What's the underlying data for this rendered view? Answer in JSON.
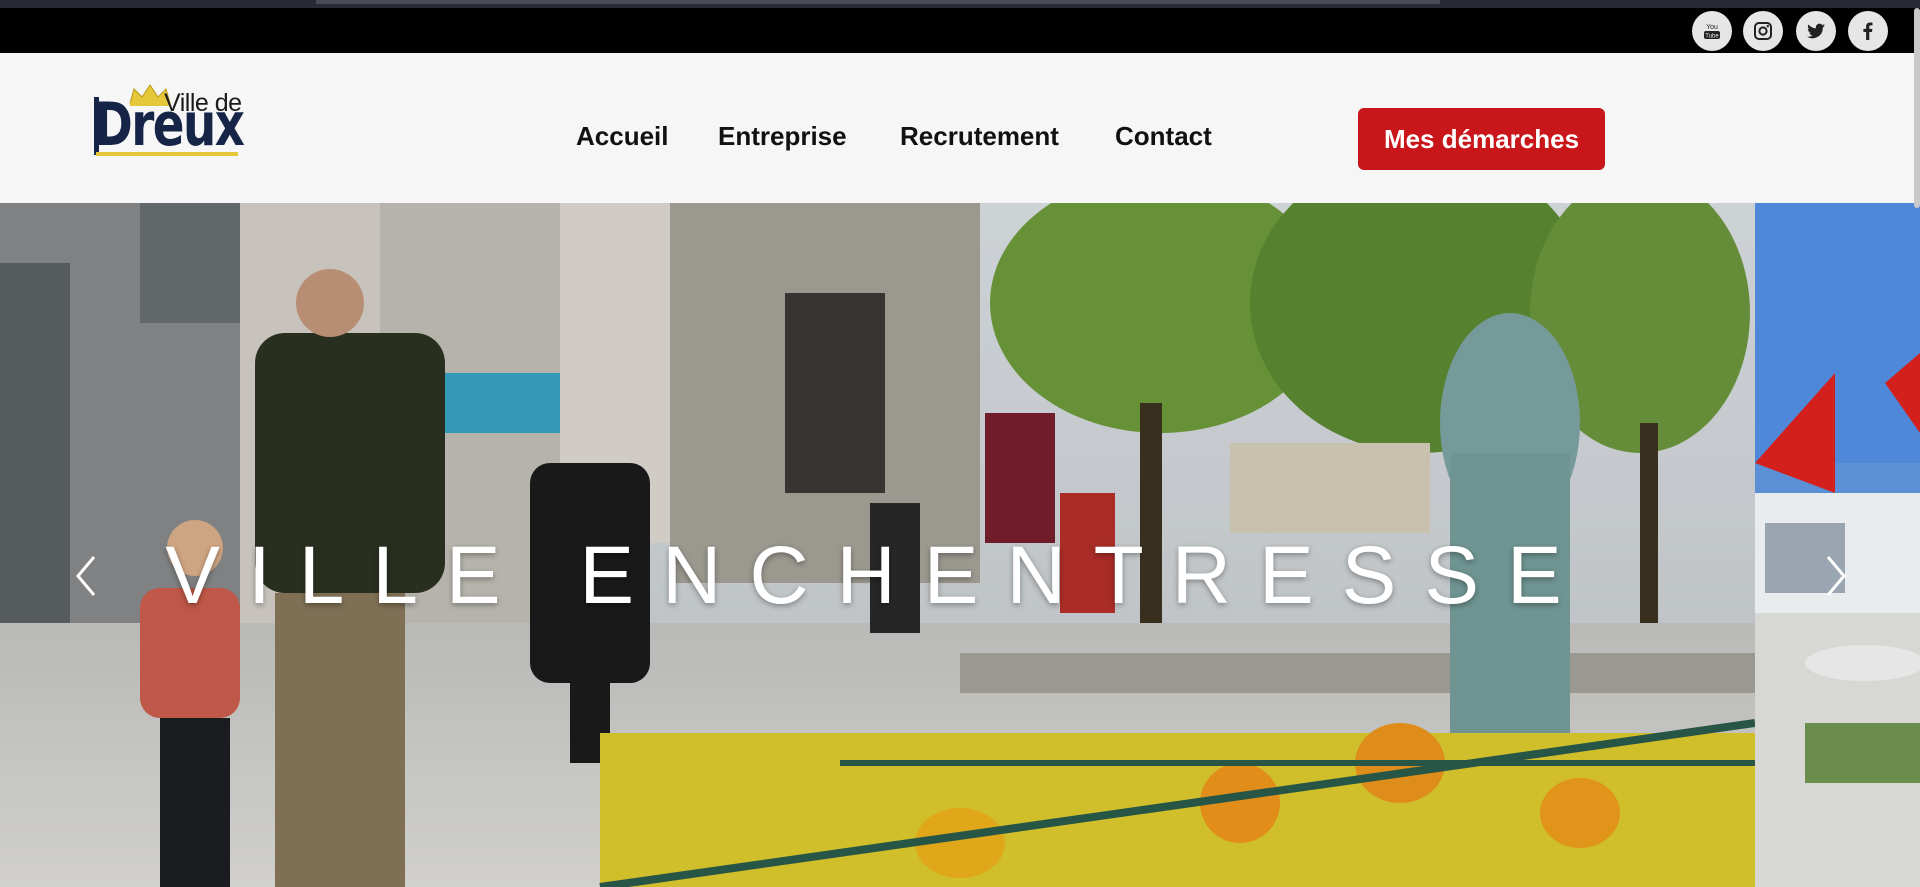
{
  "social": {
    "youtube": {
      "label": "You Tube",
      "icon": "youtube-icon"
    },
    "instagram": {
      "icon": "instagram-icon"
    },
    "twitter": {
      "icon": "twitter-icon"
    },
    "facebook": {
      "icon": "facebook-icon"
    }
  },
  "logo": {
    "small": "Ville de",
    "big": "Dreux"
  },
  "nav": {
    "items": [
      {
        "label": "Accueil"
      },
      {
        "label": "Entreprise"
      },
      {
        "label": "Recrutement"
      },
      {
        "label": "Contact"
      }
    ],
    "cta": "Mes démarches"
  },
  "hero": {
    "title": "VILLE ENCHENTRESSE",
    "prev_icon": "chevron-left-icon",
    "next_icon": "chevron-right-icon"
  },
  "colors": {
    "brand_red": "#c8161a",
    "logo_navy": "#162447",
    "logo_gold": "#e5c73a",
    "social_bar": "#000000"
  }
}
